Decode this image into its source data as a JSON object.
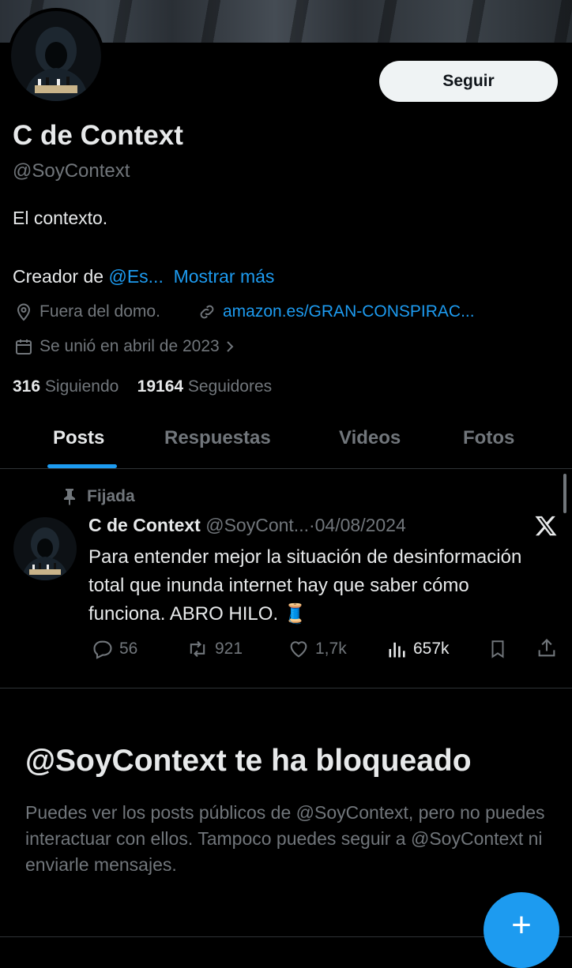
{
  "profile": {
    "name": "C de Context",
    "handle": "@SoyContext",
    "bio_line1": "El contexto.",
    "bio_prefix": "Creador de ",
    "bio_mention": "@Es...",
    "show_more": "Mostrar más",
    "location": "Fuera del domo.",
    "website": "amazon.es/GRAN-CONSPIRAC...",
    "joined": "Se unió en abril de 2023",
    "following_count": "316",
    "following_label": "Siguiendo",
    "followers_count": "19164",
    "followers_label": "Seguidores"
  },
  "follow_button": {
    "label": "Seguir"
  },
  "tabs": [
    {
      "label": "Posts",
      "active": true
    },
    {
      "label": "Respuestas",
      "active": false
    },
    {
      "label": "Videos",
      "active": false
    },
    {
      "label": "Fotos",
      "active": false
    }
  ],
  "pinned_post": {
    "pinned_label": "Fijada",
    "author_name": "C de Context",
    "author_handle": "@SoyCont...",
    "separator": "·",
    "date": "04/08/2024",
    "text": "Para entender mejor la situación de desinformación total que inunda internet hay que saber cómo funciona. ABRO HILO. 🧵",
    "replies": "56",
    "reposts": "921",
    "likes": "1,7k",
    "views": "657k"
  },
  "blocked": {
    "title": "@SoyContext te ha bloqueado",
    "description": "Puedes ver los posts públicos de @SoyContext, pero no puedes interactuar con ellos. Tampoco puedes seguir a @SoyContext ni enviarle mensajes."
  },
  "fab": {
    "label": "+"
  },
  "colors": {
    "background": "#000000",
    "text": "#e7e9ea",
    "secondary_text": "#71767b",
    "accent": "#1d9bf0",
    "button_bg": "#eff3f4"
  }
}
